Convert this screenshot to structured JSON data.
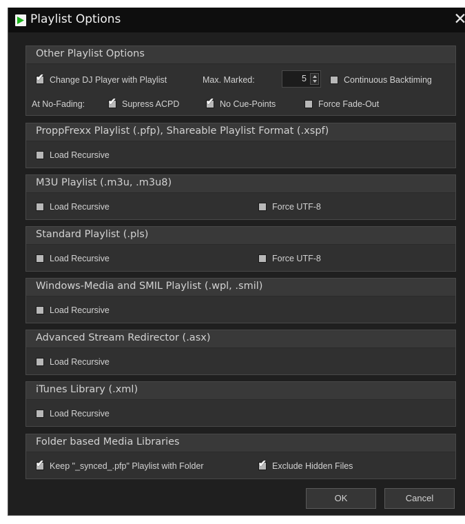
{
  "window": {
    "title": "Playlist Options",
    "close_glyph": "✕"
  },
  "icons": [
    "app-play-icon",
    "close-icon",
    "checkbox-icon",
    "spin-up-icon",
    "spin-down-icon"
  ],
  "colors": {
    "window_bg": "#1f1f1f",
    "titlebar_bg": "#0e0e0e",
    "group_bg": "#303030",
    "group_header_bg": "#393939",
    "text": "#d2d2d2",
    "app_icon_green": "#1bb31b"
  },
  "groups": {
    "other": {
      "title": "Other Playlist Options",
      "change_dj": {
        "label": "Change DJ Player with Playlist",
        "checked": true
      },
      "max_marked_label": "Max. Marked:",
      "max_marked_value": "5",
      "continuous_backtiming": {
        "label": "Continuous Backtiming",
        "checked": false
      },
      "at_no_fading_label": "At No-Fading:",
      "supress_acpd": {
        "label": "Supress ACPD",
        "checked": true
      },
      "no_cue_points": {
        "label": "No Cue-Points",
        "checked": true
      },
      "force_fade_out": {
        "label": "Force Fade-Out",
        "checked": false
      }
    },
    "pfp": {
      "title": "ProppFrexx Playlist (.pfp), Shareable Playlist Format (.xspf)",
      "load_recursive": {
        "label": "Load Recursive",
        "checked": false
      }
    },
    "m3u": {
      "title": "M3U Playlist (.m3u, .m3u8)",
      "load_recursive": {
        "label": "Load Recursive",
        "checked": false
      },
      "force_utf8": {
        "label": "Force UTF-8",
        "checked": false
      }
    },
    "pls": {
      "title": "Standard Playlist (.pls)",
      "load_recursive": {
        "label": "Load Recursive",
        "checked": false
      },
      "force_utf8": {
        "label": "Force UTF-8",
        "checked": false
      }
    },
    "wpl": {
      "title": "Windows-Media and SMIL Playlist (.wpl, .smil)",
      "load_recursive": {
        "label": "Load Recursive",
        "checked": false
      }
    },
    "asx": {
      "title": "Advanced Stream Redirector (.asx)",
      "load_recursive": {
        "label": "Load Recursive",
        "checked": false
      }
    },
    "itunes": {
      "title": "iTunes Library (.xml)",
      "load_recursive": {
        "label": "Load Recursive",
        "checked": false
      }
    },
    "folder": {
      "title": "Folder based Media Libraries",
      "keep_synced": {
        "label": "Keep \"_synced_.pfp\" Playlist with Folder",
        "checked": true
      },
      "exclude_hidden": {
        "label": "Exclude Hidden Files",
        "checked": true
      }
    }
  },
  "buttons": {
    "ok": "OK",
    "cancel": "Cancel"
  }
}
